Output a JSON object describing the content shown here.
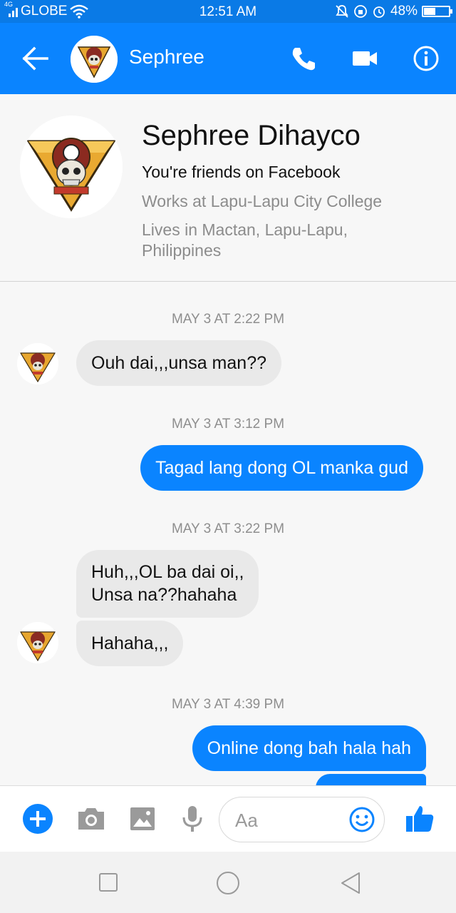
{
  "status_bar": {
    "network": "4G",
    "carrier": "GLOBE",
    "time": "12:51 AM",
    "battery_percent_label": "48%",
    "battery_level": 0.48
  },
  "header": {
    "contact_name": "Sephree",
    "icons": [
      "back-arrow-icon",
      "phone-icon",
      "video-camera-icon",
      "info-icon"
    ]
  },
  "profile": {
    "full_name": "Sephree Dihayco",
    "friends_text": "You're friends on Facebook",
    "work_text": "Works at Lapu-Lapu City College",
    "lives_text": "Lives in Mactan, Lapu-Lapu, Philippines"
  },
  "conversation": {
    "timestamps": [
      "MAY 3 AT 2:22 PM",
      "MAY 3 AT 3:12 PM",
      "MAY 3 AT 3:22 PM",
      "MAY 3 AT 4:39 PM"
    ],
    "messages": [
      {
        "from": "them",
        "text": "Ouh dai,,,unsa man??"
      },
      {
        "from": "me",
        "text": "Tagad lang dong OL manka gud"
      },
      {
        "from": "them",
        "text": "Huh,,,OL ba dai oi,,\nUnsa na??hahaha"
      },
      {
        "from": "them",
        "text": "Hahaha,,,"
      },
      {
        "from": "me",
        "text": "Online dong bah hala hah"
      }
    ]
  },
  "composer": {
    "placeholder": "Aa",
    "icons": [
      "plus-icon",
      "camera-icon",
      "gallery-icon",
      "microphone-icon",
      "emoji-icon",
      "thumbs-up-icon"
    ]
  },
  "colors": {
    "brand_blue": "#0a84ff",
    "status_bar": "#0a7ae6",
    "incoming_bubble": "#e9e9e9",
    "timestamp_gray": "#8e8e8e"
  }
}
